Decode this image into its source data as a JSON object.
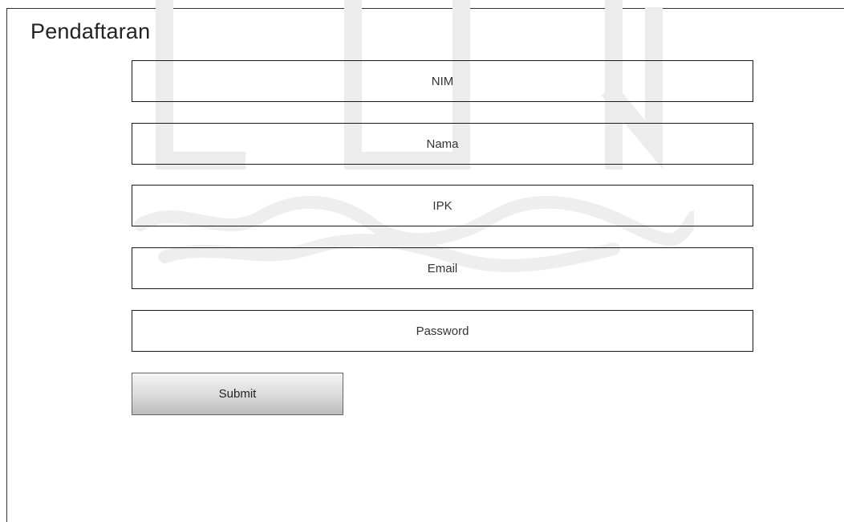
{
  "page": {
    "title": "Pendaftaran"
  },
  "form": {
    "fields": [
      {
        "placeholder": "NIM",
        "value": ""
      },
      {
        "placeholder": "Nama",
        "value": ""
      },
      {
        "placeholder": "IPK",
        "value": ""
      },
      {
        "placeholder": "Email",
        "value": ""
      },
      {
        "placeholder": "Password",
        "value": ""
      }
    ],
    "submit_label": "Submit"
  },
  "colors": {
    "border": "#1a1a1a",
    "text": "#333333",
    "button_gradient_top": "#f4f4f4",
    "button_gradient_bottom": "#bdbdbd",
    "watermark": "#ececec"
  },
  "watermark": {
    "icon": "university-logo-icon"
  }
}
